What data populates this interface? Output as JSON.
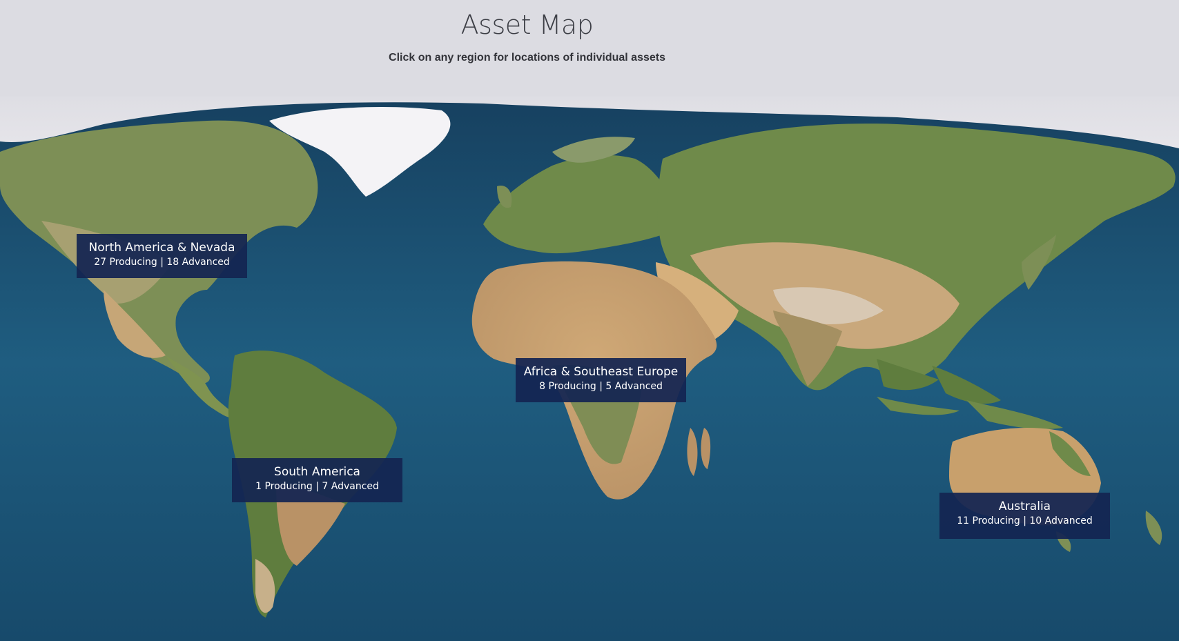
{
  "header": {
    "title": "Asset Map",
    "subtitle": "Click on any region for locations of individual assets"
  },
  "map": {
    "ocean_color": "#1d5c7e",
    "polar_color": "#e9e9ee",
    "land_colors": {
      "forest": "#6f8a4a",
      "desert": "#cfa876",
      "tundra": "#b3a98f",
      "ice": "#f4f3f6"
    }
  },
  "regions": [
    {
      "name": "North America & Nevada",
      "stats": "27 Producing | 18 Advanced"
    },
    {
      "name": "Africa & Southeast Europe",
      "stats": "8 Producing | 5 Advanced"
    },
    {
      "name": "South America",
      "stats": "1 Producing | 7 Advanced"
    },
    {
      "name": "Australia",
      "stats": "11 Producing | 10 Advanced"
    }
  ],
  "card_color": "#132552"
}
